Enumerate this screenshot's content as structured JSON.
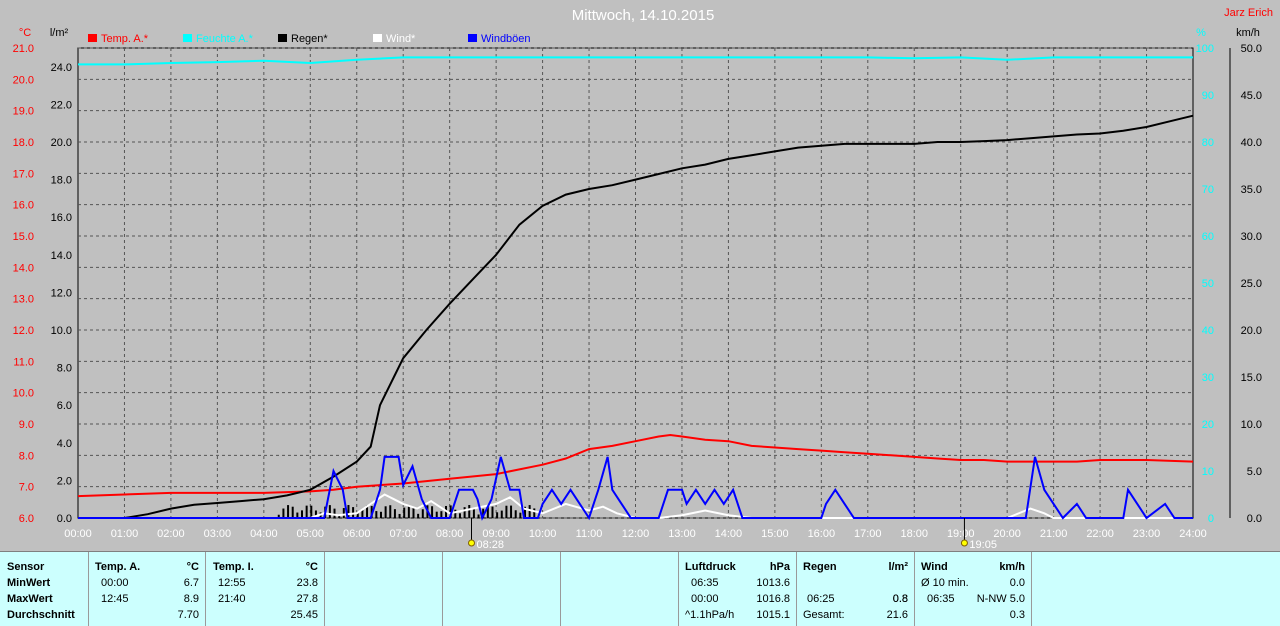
{
  "header": {
    "title": "Mittwoch, 14.10.2015",
    "author": "Jarz Erich"
  },
  "units": {
    "left_outer": "°C",
    "left_inner": "l/m²",
    "right_inner": "%",
    "right_outer": "km/h"
  },
  "legend": [
    {
      "label": "Temp. A.*",
      "color": "#ff0000"
    },
    {
      "label": "Feuchte A.*",
      "color": "#00ffff"
    },
    {
      "label": "Regen*",
      "color": "#000000"
    },
    {
      "label": "Wind*",
      "color": "#ffffff"
    },
    {
      "label": "Windböen",
      "color": "#0000ff"
    }
  ],
  "chart_data": {
    "type": "line",
    "title": "Mittwoch, 14.10.2015",
    "x_ticks": [
      "00:00",
      "01:00",
      "02:00",
      "03:00",
      "04:00",
      "05:00",
      "06:00",
      "07:00",
      "08:00",
      "09:00",
      "10:00",
      "11:00",
      "12:00",
      "13:00",
      "14:00",
      "15:00",
      "16:00",
      "17:00",
      "18:00",
      "19:00",
      "20:00",
      "21:00",
      "22:00",
      "23:00",
      "24:00"
    ],
    "xlim": [
      0,
      24
    ],
    "axes": {
      "temperature": {
        "unit": "°C",
        "lim": [
          6,
          21
        ],
        "ticks": [
          "6.0",
          "7.0",
          "8.0",
          "9.0",
          "10.0",
          "11.0",
          "12.0",
          "13.0",
          "14.0",
          "15.0",
          "16.0",
          "17.0",
          "18.0",
          "19.0",
          "20.0",
          "21.0"
        ]
      },
      "rain": {
        "unit": "l/m²",
        "lim": [
          0,
          25
        ],
        "ticks": [
          "0.0",
          "2.0",
          "4.0",
          "6.0",
          "8.0",
          "10.0",
          "12.0",
          "14.0",
          "16.0",
          "18.0",
          "20.0",
          "22.0",
          "24.0"
        ]
      },
      "humidity": {
        "unit": "%",
        "lim": [
          0,
          100
        ],
        "ticks": [
          "0",
          "10",
          "20",
          "30",
          "40",
          "50",
          "60",
          "70",
          "80",
          "90",
          "100"
        ]
      },
      "wind": {
        "unit": "km/h",
        "lim": [
          0,
          50
        ],
        "ticks": [
          "0.0",
          "5.0",
          "10.0",
          "15.0",
          "20.0",
          "25.0",
          "30.0",
          "35.0",
          "40.0",
          "45.0",
          "50.0"
        ]
      }
    },
    "sun_markers": [
      {
        "label": "08:28",
        "hour": 8.47
      },
      {
        "label": "19:05",
        "hour": 19.08
      }
    ],
    "series": [
      {
        "name": "Temp. A.*",
        "axis": "temperature",
        "color": "#ff0000",
        "points": [
          [
            0,
            6.7
          ],
          [
            1,
            6.75
          ],
          [
            2,
            6.8
          ],
          [
            3,
            6.8
          ],
          [
            4,
            6.8
          ],
          [
            5,
            6.85
          ],
          [
            5.5,
            6.9
          ],
          [
            6,
            7.0
          ],
          [
            7,
            7.1
          ],
          [
            8,
            7.25
          ],
          [
            9,
            7.4
          ],
          [
            9.5,
            7.55
          ],
          [
            10,
            7.7
          ],
          [
            10.5,
            7.9
          ],
          [
            11,
            8.2
          ],
          [
            11.5,
            8.3
          ],
          [
            12,
            8.45
          ],
          [
            12.5,
            8.6
          ],
          [
            12.75,
            8.65
          ],
          [
            13,
            8.6
          ],
          [
            13.5,
            8.5
          ],
          [
            14,
            8.45
          ],
          [
            14.5,
            8.3
          ],
          [
            15,
            8.25
          ],
          [
            15.5,
            8.2
          ],
          [
            16,
            8.15
          ],
          [
            16.5,
            8.1
          ],
          [
            17,
            8.05
          ],
          [
            17.5,
            8.0
          ],
          [
            18,
            7.95
          ],
          [
            18.5,
            7.9
          ],
          [
            19,
            7.85
          ],
          [
            19.5,
            7.85
          ],
          [
            20,
            7.8
          ],
          [
            20.5,
            7.8
          ],
          [
            21,
            7.8
          ],
          [
            21.5,
            7.8
          ],
          [
            22,
            7.85
          ],
          [
            22.5,
            7.85
          ],
          [
            23,
            7.85
          ],
          [
            24,
            7.8
          ]
        ]
      },
      {
        "name": "Feuchte A.*",
        "axis": "humidity",
        "color": "#00ffff",
        "points": [
          [
            0,
            96.5
          ],
          [
            1,
            96.5
          ],
          [
            2,
            96.8
          ],
          [
            3,
            97.0
          ],
          [
            4,
            97.3
          ],
          [
            5,
            96.8
          ],
          [
            6,
            97.5
          ],
          [
            7,
            98.0
          ],
          [
            8,
            98.0
          ],
          [
            10,
            98.0
          ],
          [
            12,
            98.0
          ],
          [
            14,
            98.0
          ],
          [
            16,
            98.0
          ],
          [
            17,
            98.0
          ],
          [
            18,
            97.8
          ],
          [
            19,
            98.0
          ],
          [
            20,
            97.5
          ],
          [
            21,
            98.0
          ],
          [
            22,
            98.0
          ],
          [
            23,
            98.0
          ],
          [
            24,
            98.0
          ]
        ]
      },
      {
        "name": "Regen*",
        "axis": "rain",
        "color": "#000000",
        "points": [
          [
            0,
            0.0
          ],
          [
            1,
            0.0
          ],
          [
            1.5,
            0.2
          ],
          [
            2,
            0.5
          ],
          [
            2.5,
            0.7
          ],
          [
            3,
            0.8
          ],
          [
            3.5,
            0.9
          ],
          [
            4,
            1.0
          ],
          [
            4.5,
            1.2
          ],
          [
            5,
            1.5
          ],
          [
            5.5,
            2.2
          ],
          [
            6,
            3.0
          ],
          [
            6.3,
            3.8
          ],
          [
            6.5,
            6.0
          ],
          [
            6.8,
            7.5
          ],
          [
            7,
            8.5
          ],
          [
            7.5,
            10.0
          ],
          [
            8,
            11.4
          ],
          [
            8.5,
            12.7
          ],
          [
            9,
            14.0
          ],
          [
            9.5,
            15.6
          ],
          [
            10,
            16.6
          ],
          [
            10.5,
            17.2
          ],
          [
            11,
            17.5
          ],
          [
            11.5,
            17.7
          ],
          [
            12,
            18.0
          ],
          [
            12.5,
            18.3
          ],
          [
            13,
            18.6
          ],
          [
            13.5,
            18.8
          ],
          [
            14,
            19.1
          ],
          [
            14.5,
            19.3
          ],
          [
            15,
            19.5
          ],
          [
            15.5,
            19.7
          ],
          [
            16,
            19.8
          ],
          [
            16.5,
            19.9
          ],
          [
            17,
            19.9
          ],
          [
            18,
            19.9
          ],
          [
            18.5,
            20.0
          ],
          [
            19,
            20.0
          ],
          [
            19.5,
            20.05
          ],
          [
            20,
            20.1
          ],
          [
            20.5,
            20.2
          ],
          [
            21,
            20.3
          ],
          [
            21.5,
            20.4
          ],
          [
            22,
            20.45
          ],
          [
            22.5,
            20.6
          ],
          [
            23,
            20.8
          ],
          [
            23.5,
            21.1
          ],
          [
            24,
            21.4
          ]
        ]
      },
      {
        "name": "Wind*",
        "axis": "wind",
        "color": "#ffffff",
        "points": [
          [
            0,
            0
          ],
          [
            5,
            0
          ],
          [
            5.3,
            0.5
          ],
          [
            5.6,
            0.3
          ],
          [
            6,
            0.5
          ],
          [
            6.3,
            1.5
          ],
          [
            6.6,
            2.5
          ],
          [
            6.8,
            2.0
          ],
          [
            7,
            1.5
          ],
          [
            7.3,
            1.0
          ],
          [
            7.6,
            1.8
          ],
          [
            8,
            0.5
          ],
          [
            8.5,
            1.0
          ],
          [
            9,
            1.5
          ],
          [
            9.3,
            2.2
          ],
          [
            9.6,
            1.0
          ],
          [
            10,
            0.5
          ],
          [
            10.5,
            1.5
          ],
          [
            11,
            0.8
          ],
          [
            11.3,
            1.2
          ],
          [
            11.6,
            0.5
          ],
          [
            12,
            0
          ],
          [
            12.5,
            0
          ],
          [
            13,
            0.3
          ],
          [
            13.5,
            0.8
          ],
          [
            14,
            0.3
          ],
          [
            14.5,
            0
          ],
          [
            20,
            0
          ],
          [
            20.5,
            1.0
          ],
          [
            20.8,
            0.5
          ],
          [
            21,
            0
          ],
          [
            24,
            0
          ]
        ]
      },
      {
        "name": "Windböen",
        "axis": "wind",
        "color": "#0000ff",
        "points": [
          [
            0,
            0
          ],
          [
            5.3,
            0
          ],
          [
            5.5,
            5
          ],
          [
            5.7,
            3
          ],
          [
            5.8,
            0
          ],
          [
            6.3,
            0
          ],
          [
            6.5,
            3
          ],
          [
            6.6,
            6.5
          ],
          [
            6.9,
            6.5
          ],
          [
            7,
            3.5
          ],
          [
            7.2,
            5.5
          ],
          [
            7.4,
            2
          ],
          [
            7.6,
            0
          ],
          [
            8,
            0
          ],
          [
            8.2,
            3
          ],
          [
            8.5,
            3
          ],
          [
            8.6,
            2
          ],
          [
            8.7,
            0
          ],
          [
            8.9,
            2
          ],
          [
            9.1,
            6.5
          ],
          [
            9.3,
            3
          ],
          [
            9.5,
            3
          ],
          [
            9.6,
            0
          ],
          [
            9.9,
            0
          ],
          [
            10,
            1.5
          ],
          [
            10.2,
            3
          ],
          [
            10.4,
            1.5
          ],
          [
            10.6,
            3
          ],
          [
            10.8,
            1.5
          ],
          [
            11,
            0
          ],
          [
            11.2,
            3
          ],
          [
            11.4,
            6.5
          ],
          [
            11.5,
            3
          ],
          [
            11.7,
            1.5
          ],
          [
            11.9,
            0
          ],
          [
            12.5,
            0
          ],
          [
            12.7,
            3
          ],
          [
            13,
            3
          ],
          [
            13.1,
            1.5
          ],
          [
            13.3,
            3
          ],
          [
            13.5,
            1.5
          ],
          [
            13.7,
            3
          ],
          [
            13.9,
            1.5
          ],
          [
            14.1,
            3
          ],
          [
            14.3,
            0
          ],
          [
            16,
            0
          ],
          [
            16.1,
            1.5
          ],
          [
            16.3,
            3
          ],
          [
            16.5,
            1.5
          ],
          [
            16.7,
            0
          ],
          [
            20.4,
            0
          ],
          [
            20.6,
            6.5
          ],
          [
            20.8,
            3
          ],
          [
            21,
            1.5
          ],
          [
            21.2,
            0
          ],
          [
            21.5,
            1.5
          ],
          [
            21.7,
            0
          ],
          [
            22.5,
            0
          ],
          [
            22.6,
            3
          ],
          [
            22.8,
            1.5
          ],
          [
            23,
            0
          ],
          [
            23.4,
            1.5
          ],
          [
            23.6,
            0
          ],
          [
            24,
            0
          ]
        ]
      }
    ],
    "rain_bars": [
      {
        "from": 4.3,
        "to": 9.8
      }
    ]
  },
  "stats": {
    "sensor": {
      "header": "Sensor",
      "rows": [
        "MinWert",
        "MaxWert",
        "Durchschnitt"
      ]
    },
    "temp_a": {
      "header": "Temp. A.",
      "unit": "°C",
      "rows": [
        [
          "00:00",
          "6.7"
        ],
        [
          "12:45",
          "8.9"
        ],
        [
          "",
          "7.70"
        ]
      ]
    },
    "temp_i": {
      "header": "Temp. I.",
      "unit": "°C",
      "rows": [
        [
          "12:55",
          "23.8"
        ],
        [
          "21:40",
          "27.8"
        ],
        [
          "",
          "25.45"
        ]
      ]
    },
    "luftdruck": {
      "header": "Luftdruck",
      "unit": "hPa",
      "rows": [
        [
          "06:35",
          "1013.6"
        ],
        [
          "00:00",
          "1016.8"
        ],
        [
          "^1.1hPa/h",
          "1015.1"
        ]
      ]
    },
    "regen": {
      "header": "Regen",
      "unit": "l/m²",
      "rows": [
        [
          "",
          "0.8"
        ],
        [
          "06:25",
          "0.8"
        ],
        [
          "Gesamt:",
          "21.6"
        ]
      ]
    },
    "wind": {
      "header": "Wind",
      "unit": "km/h",
      "rows": [
        [
          "Ø 10 min.",
          "0.0"
        ],
        [
          "06:35",
          "N-NW 5.0"
        ],
        [
          "",
          "0.3"
        ]
      ]
    }
  }
}
